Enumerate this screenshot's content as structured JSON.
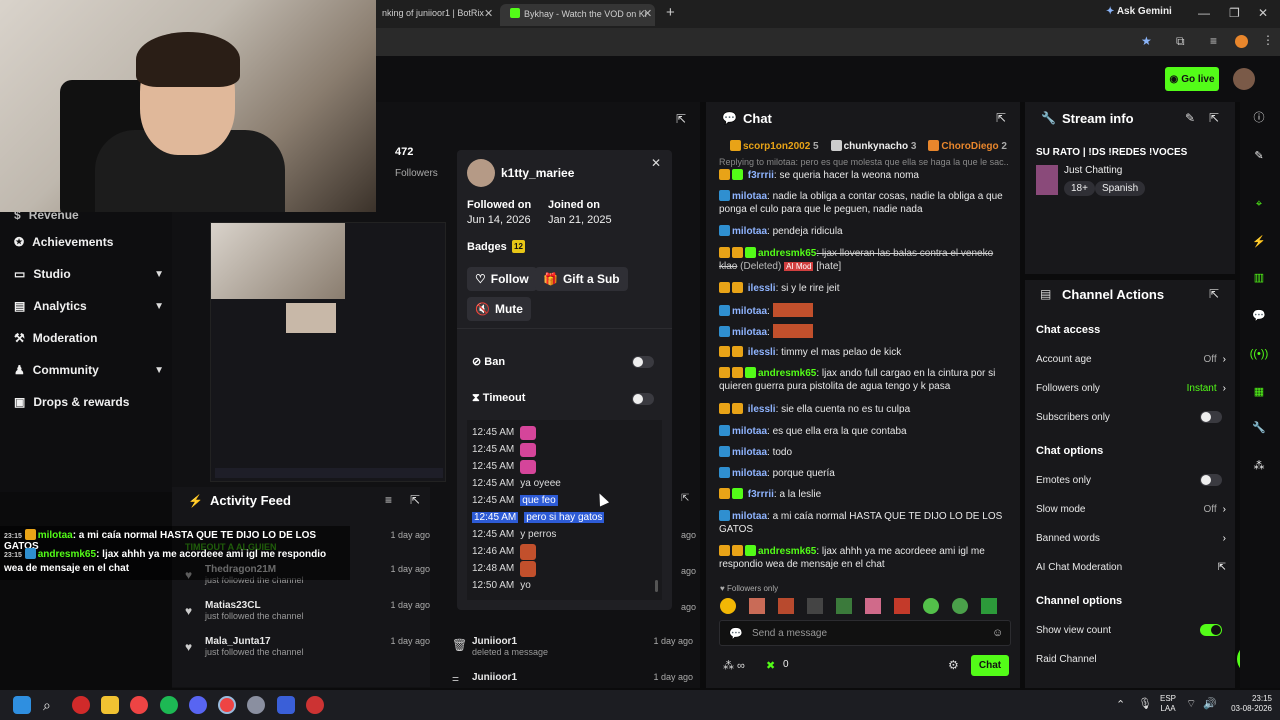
{
  "browser": {
    "tabs": [
      "nking of juniioor1 | BotRix",
      "Bykhay - Watch the VOD on Ki"
    ],
    "ask_gemini": "Ask Gemini",
    "new_tab": "+"
  },
  "header": {
    "go_live": "Go live"
  },
  "sidebar": {
    "items": [
      {
        "label": "Revenue",
        "icon": "revenue-icon"
      },
      {
        "label": "Achievements",
        "icon": "achievements-icon"
      },
      {
        "label": "Studio",
        "icon": "studio-icon",
        "expandable": true
      },
      {
        "label": "Analytics",
        "icon": "analytics-icon",
        "expandable": true
      },
      {
        "label": "Moderation",
        "icon": "moderation-icon"
      },
      {
        "label": "Community",
        "icon": "community-icon",
        "expandable": true
      },
      {
        "label": "Drops & rewards",
        "icon": "drops-icon"
      }
    ]
  },
  "stats": {
    "followers_count": "472",
    "followers_label": "Followers"
  },
  "user_card": {
    "username": "k1tty_mariee",
    "followed_on_label": "Followed on",
    "followed_on": "Jun 14, 2026",
    "joined_on_label": "Joined on",
    "joined_on": "Jan 21, 2025",
    "badges_label": "Badges",
    "badges_count": "12",
    "follow": "Follow",
    "gift_sub": "Gift a Sub",
    "mute": "Mute",
    "ban": "Ban",
    "timeout": "Timeout",
    "history": [
      {
        "time": "12:45 AM",
        "text": "",
        "emote": true,
        "selected": false
      },
      {
        "time": "12:45 AM",
        "text": "",
        "emote": true,
        "selected": false
      },
      {
        "time": "12:45 AM",
        "text": "",
        "emote": true,
        "selected": false
      },
      {
        "time": "12:45 AM",
        "text": "ya oyeee",
        "emote": false,
        "selected": false
      },
      {
        "time": "12:45 AM",
        "text": "que feo",
        "emote": false,
        "selected": "partial"
      },
      {
        "time": "12:45 AM",
        "text": "pero si hay gatos",
        "emote": false,
        "selected": true
      },
      {
        "time": "12:45 AM",
        "text": "y perros",
        "emote": false,
        "selected": false
      },
      {
        "time": "12:46 AM",
        "text": "",
        "emote": true,
        "selected": false
      },
      {
        "time": "12:48 AM",
        "text": "",
        "emote": true,
        "selected": false
      },
      {
        "time": "12:50 AM",
        "text": "yo",
        "emote": false,
        "selected": false
      }
    ]
  },
  "activity": {
    "title": "Activity Feed",
    "items": [
      {
        "name": "",
        "sub": "",
        "time": "1 day ago"
      },
      {
        "name": "Thedragon21M",
        "sub": "just followed the channel",
        "time": "1 day ago"
      },
      {
        "name": "Matias23CL",
        "sub": "just followed the channel",
        "time": "1 day ago"
      },
      {
        "name": "Mala_Junta17",
        "sub": "just followed the channel",
        "time": "1 day ago"
      }
    ],
    "mod_items": [
      {
        "name": "Juniioor1",
        "sub": "deleted a message",
        "time": "1 day ago"
      },
      {
        "name": "Juniioor1",
        "sub": "",
        "time": "1 day ago"
      }
    ],
    "faded_label": "TIMEOUT A ALGUIEN",
    "right_ago": [
      "ago",
      "ago",
      "ago",
      "ago"
    ]
  },
  "overlay_chat": [
    {
      "time": "23:15",
      "user": "milotaa",
      "text": ": a mi caía normal HASTA QUE TE DIJO LO DE LOS GATOS"
    },
    {
      "time": "23:15",
      "user": "andresmk65",
      "text": ": ljax ahhh ya me acordeee ami igl me respondio wea de mensaje en el chat"
    }
  ],
  "chat": {
    "title": "Chat",
    "top_gifters": [
      {
        "name": "scorp1on2002",
        "count": "5"
      },
      {
        "name": "chunkynacho",
        "count": "3"
      },
      {
        "name": "ChoroDiego",
        "count": "2"
      }
    ],
    "replying": "Replying to milotaa: pero es que molesta que ella se haga la que le sac...",
    "messages": [
      {
        "user": "f3rrrii",
        "text": ": se queria hacer la weona noma"
      },
      {
        "user": "milotaa",
        "text": ": nadie la obliga a contar cosas, nadie la obliga a que ponga el culo para que le peguen, nadie nada"
      },
      {
        "user": "milotaa",
        "text": ": pendeja ridicula"
      },
      {
        "user": "andresmk65",
        "text": ": ljax lloveran las balas contra el veneko klao",
        "deleted": "(Deleted)",
        "mod": "AI Mod",
        "tag": "[hate]"
      },
      {
        "user": "ilessli",
        "text": ": si y le rire jeit"
      },
      {
        "user": "milotaa",
        "text": ":"
      },
      {
        "user": "milotaa",
        "text": ":"
      },
      {
        "user": "ilessli",
        "text": ": timmy el mas pelao de kick"
      },
      {
        "user": "andresmk65",
        "text": ": ljax ando full cargao en la cintura por si quieren guerra pura pistolita de agua tengo y k pasa"
      },
      {
        "user": "ilessli",
        "text": ": sie ella cuenta no es tu culpa"
      },
      {
        "user": "milotaa",
        "text": ": es que ella era la que contaba"
      },
      {
        "user": "milotaa",
        "text": ": todo"
      },
      {
        "user": "milotaa",
        "text": ": porque quería"
      },
      {
        "user": "f3rrrii",
        "text": ": a la leslie"
      },
      {
        "user": "milotaa",
        "text": ": a mi caía normal HASTA QUE TE DIJO LO DE LOS GATOS"
      },
      {
        "user": "andresmk65",
        "text": ": ljax ahhh ya me acordeee ami igl me respondio wea de mensaje en el chat"
      }
    ],
    "followers_only": "Followers only",
    "placeholder": "Send a message",
    "points": "0",
    "send": "Chat"
  },
  "stream_info": {
    "title": "Stream info",
    "stream_title": "SU RATO | !DS !REDES !VOCES",
    "category": "Just Chatting",
    "tags": [
      "18+",
      "Spanish"
    ]
  },
  "channel_actions": {
    "title": "Channel Actions",
    "chat_access": "Chat access",
    "account_age": "Account age",
    "account_age_val": "Off",
    "followers_only": "Followers only",
    "followers_only_val": "Instant",
    "subscribers_only": "Subscribers only",
    "chat_options": "Chat options",
    "emotes_only": "Emotes only",
    "slow_mode": "Slow mode",
    "slow_mode_val": "Off",
    "banned_words": "Banned words",
    "ai_mod": "AI Chat Moderation",
    "channel_options": "Channel options",
    "show_view_count": "Show view count",
    "raid_channel": "Raid Channel",
    "notif_count": "1"
  },
  "taskbar": {
    "lang": "ESP",
    "lang2": "LAA",
    "time": "23:15",
    "date": "03-08-2026"
  },
  "colors": {
    "accent": "#53fc18",
    "bg": "#0e0e10",
    "panel": "#18181b"
  }
}
